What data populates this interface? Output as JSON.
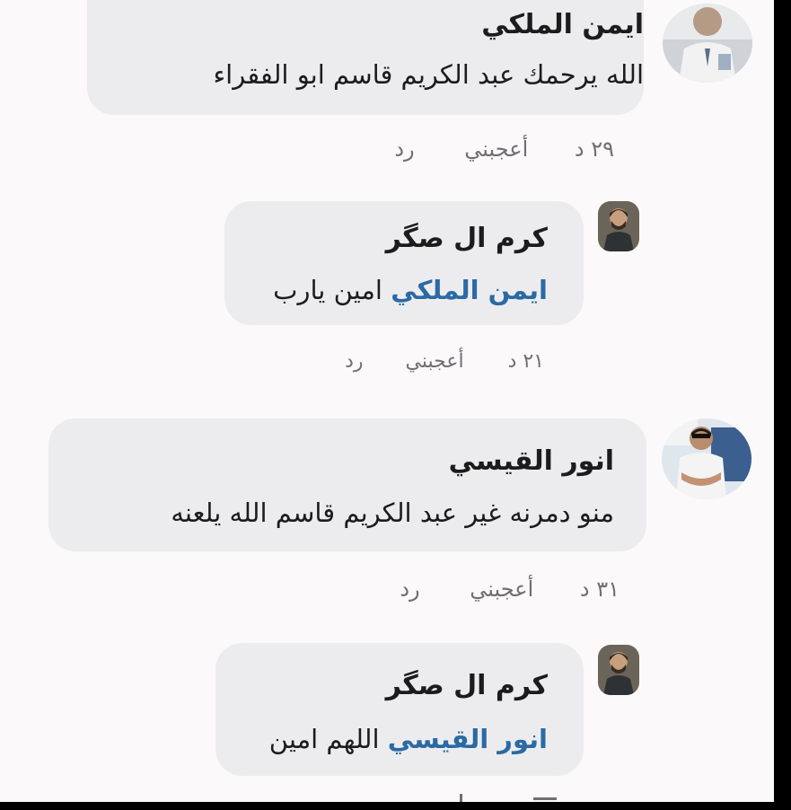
{
  "comments": [
    {
      "author": "ايمن الملكي",
      "text": "الله يرحمك عبد الكريم قاسم ابو الفقراء",
      "time": "٢٩ د",
      "like": "أعجبني",
      "reply": "رد"
    },
    {
      "author": "كرم ال صگر",
      "mention": "ايمن الملكي",
      "text": "امين يارب",
      "time": "٢١ د",
      "like": "أعجبني",
      "reply": "رد"
    },
    {
      "author": "انور القيسي",
      "text": "منو دمرنه غير عبد الكريم قاسم الله يلعنه",
      "time": "٣١ د",
      "like": "أعجبني",
      "reply": "رد"
    },
    {
      "author": "كرم ال صگر",
      "mention": "انور القيسي",
      "text": "اللهم امين"
    }
  ],
  "colors": {
    "background": "#fbf9fa",
    "bubble": "#ececef",
    "mention": "#2b6aa3",
    "meta_text": "#6f6f73",
    "frame": "#000000"
  }
}
